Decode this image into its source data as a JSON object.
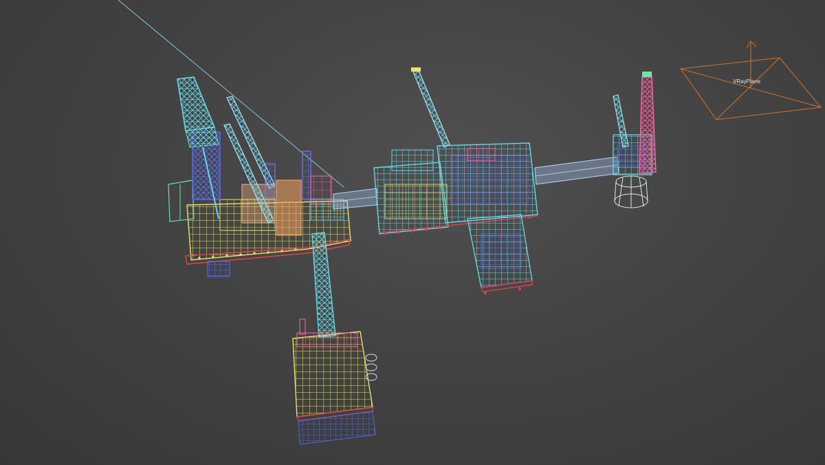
{
  "viewport": {
    "vray_plane_label": "VRayPlane"
  },
  "colors": {
    "background": "#444444",
    "cyan": "#66d9e8",
    "yellow": "#e8e36a",
    "blue": "#5a6cf0",
    "pink": "#ff66aa",
    "orange": "#f0a060",
    "green": "#66e8a0",
    "red": "#e0404a",
    "light_blue": "#a8c8f0",
    "vray_orange": "#d0742a"
  }
}
